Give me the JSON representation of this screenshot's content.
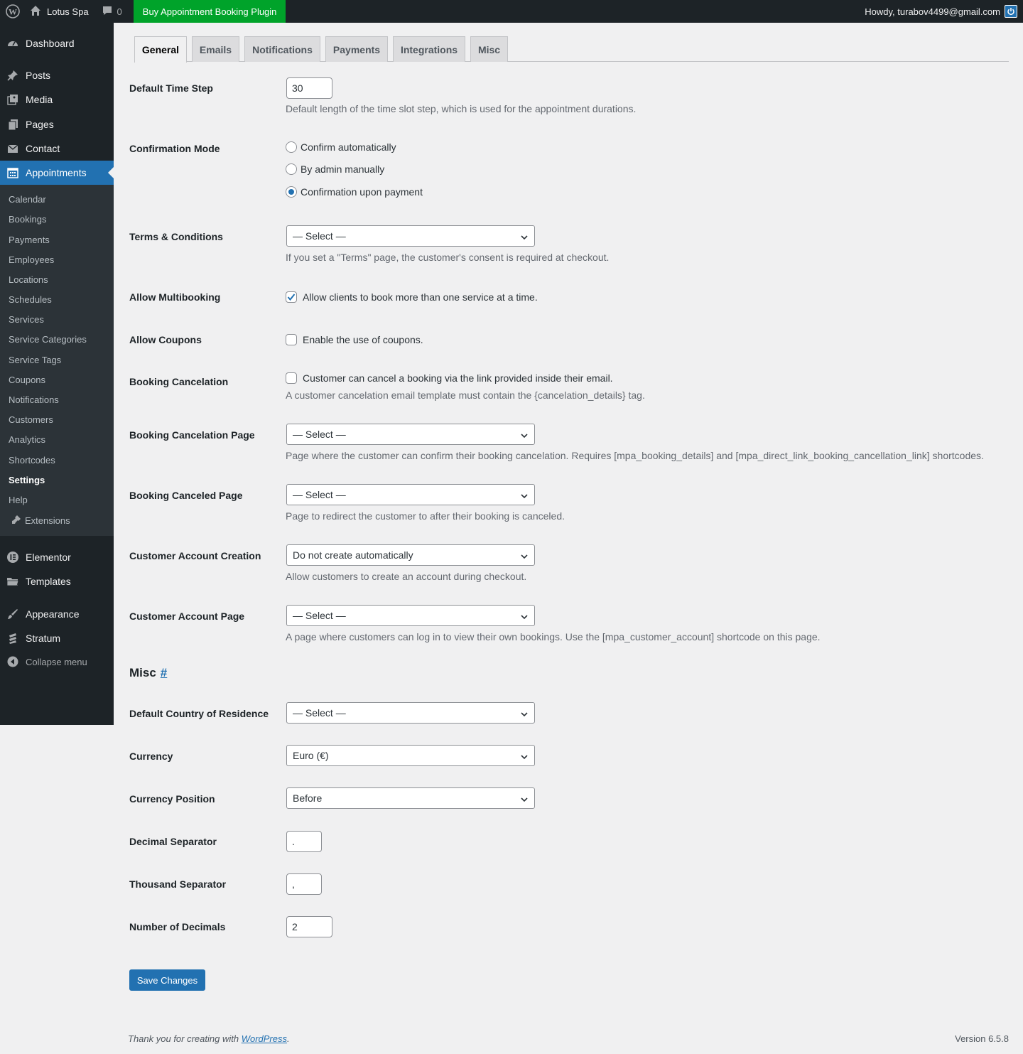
{
  "adminbar": {
    "site_name": "Lotus Spa",
    "comments_count": "0",
    "buy_label": "Buy Appointment Booking Plugin",
    "howdy": "Howdy, turabov4499@gmail.com"
  },
  "sidebar": {
    "top_items": [
      {
        "label": "Dashboard",
        "icon": "dashboard-icon"
      },
      {
        "label": "Posts",
        "icon": "pin-icon"
      },
      {
        "label": "Media",
        "icon": "media-icon"
      },
      {
        "label": "Pages",
        "icon": "pages-icon"
      },
      {
        "label": "Contact",
        "icon": "envelope-icon"
      },
      {
        "label": "Appointments",
        "icon": "calendar-icon"
      }
    ],
    "sub_items": [
      "Calendar",
      "Bookings",
      "Payments",
      "Employees",
      "Locations",
      "Schedules",
      "Services",
      "Service Categories",
      "Service Tags",
      "Coupons",
      "Notifications",
      "Customers",
      "Analytics",
      "Shortcodes",
      "Settings",
      "Help",
      "Extensions"
    ],
    "bottom_items": [
      {
        "label": "Elementor",
        "icon": "elementor-icon"
      },
      {
        "label": "Templates",
        "icon": "folder-icon"
      },
      {
        "label": "Appearance",
        "icon": "brush-icon"
      },
      {
        "label": "Stratum",
        "icon": "stratum-icon"
      }
    ],
    "collapse_label": "Collapse menu"
  },
  "tabs": [
    "General",
    "Emails",
    "Notifications",
    "Payments",
    "Integrations",
    "Misc"
  ],
  "general": {
    "time_step": {
      "label": "Default Time Step",
      "value": "30",
      "desc": "Default length of the time slot step, which is used for the appointment durations."
    },
    "confirmation": {
      "label": "Confirmation Mode",
      "options": [
        "Confirm automatically",
        "By admin manually",
        "Confirmation upon payment"
      ],
      "selected": 2
    },
    "terms": {
      "label": "Terms & Conditions",
      "value": "— Select —",
      "desc": "If you set a \"Terms\" page, the customer's consent is required at checkout."
    },
    "multibooking": {
      "label": "Allow Multibooking",
      "text": "Allow clients to book more than one service at a time.",
      "checked": true
    },
    "coupons": {
      "label": "Allow Coupons",
      "text": "Enable the use of coupons.",
      "checked": false
    },
    "cancelation": {
      "label": "Booking Cancelation",
      "text": "Customer can cancel a booking via the link provided inside their email.",
      "checked": false,
      "desc": "A customer cancelation email template must contain the {cancelation_details} tag."
    },
    "cancelation_page": {
      "label": "Booking Cancelation Page",
      "value": "— Select —",
      "desc": "Page where the customer can confirm their booking cancelation. Requires [mpa_booking_details] and [mpa_direct_link_booking_cancellation_link] shortcodes."
    },
    "canceled_page": {
      "label": "Booking Canceled Page",
      "value": "— Select —",
      "desc": "Page to redirect the customer to after their booking is canceled."
    },
    "account_creation": {
      "label": "Customer Account Creation",
      "value": "Do not create automatically",
      "desc": "Allow customers to create an account during checkout."
    },
    "account_page": {
      "label": "Customer Account Page",
      "value": "— Select —",
      "desc": "A page where customers can log in to view their own bookings. Use the [mpa_customer_account] shortcode on this page."
    }
  },
  "misc": {
    "heading": "Misc",
    "anchor": "#",
    "country": {
      "label": "Default Country of Residence",
      "value": "— Select —"
    },
    "currency": {
      "label": "Currency",
      "value": "Euro (€)"
    },
    "currency_position": {
      "label": "Currency Position",
      "value": "Before"
    },
    "decimal_sep": {
      "label": "Decimal Separator",
      "value": "."
    },
    "thousand_sep": {
      "label": "Thousand Separator",
      "value": ","
    },
    "decimals": {
      "label": "Number of Decimals",
      "value": "2"
    }
  },
  "save_label": "Save Changes",
  "footer": {
    "thanks_prefix": "Thank you for creating with ",
    "link": "WordPress",
    "suffix": ".",
    "version": "Version 6.5.8"
  },
  "colors": {
    "accent": "#2271b1",
    "buy_green": "#00a32a",
    "menu_bg": "#1d2327",
    "submenu_bg": "#2c3338"
  }
}
